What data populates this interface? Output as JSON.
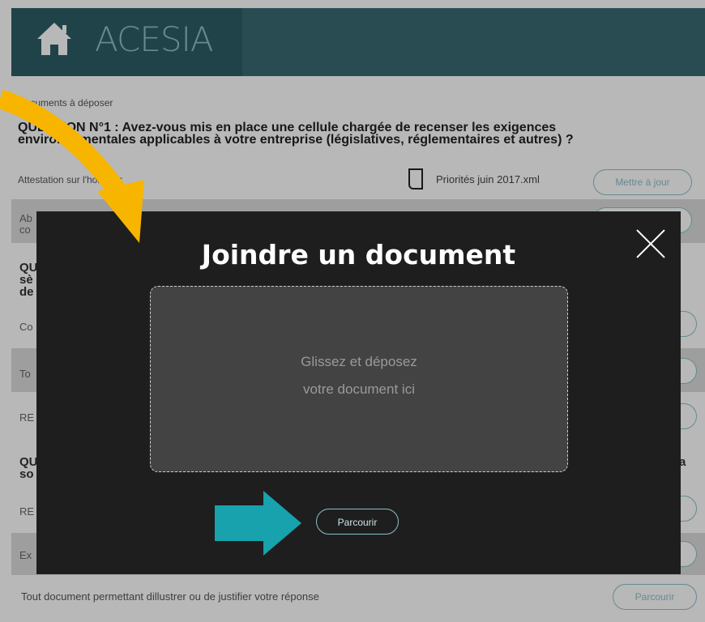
{
  "header": {
    "brand": "ACESIA",
    "home_icon": "home-icon"
  },
  "page": {
    "section_label": "Documents à déposer",
    "question1": "QUESTION N°1 : Avez-vous mis en place une cellule chargée de recenser les exigences environnementales applicables à votre entreprise (législatives, réglementaires et autres) ?",
    "row1_label": "Attestation sur l'honneur",
    "row1_file": "Priorités juin 2017.xml",
    "update_button": "Mettre à jour",
    "row2_trunc_1": "Ab",
    "row2_trunc_2": "co",
    "q2_trunc_1": "QU",
    "q2_trunc_2": "sè",
    "q2_trunc_3": "de",
    "row3_trunc": "Co",
    "row4_trunc": "To",
    "row5_trunc": "RE",
    "q3_trunc_1": "QU",
    "q3_trunc_2": "so",
    "q3_right_trunc": "a",
    "row6_trunc": "RE",
    "row7_trunc": "Ex",
    "last_row_label": "Tout document permettant dillustrer ou de justifier votre réponse",
    "last_row_button": "Parcourir"
  },
  "modal": {
    "title": "Joindre un document",
    "drop_text": "Glissez et déposez\nvotre document ici",
    "browse_button": "Parcourir",
    "close_icon": "close-icon"
  },
  "colors": {
    "header": "#3a6a73",
    "accent": "#8cc0c8",
    "modal_bg": "#1e1e1e",
    "arrow_yellow": "#f7b500",
    "arrow_teal": "#17a2ad"
  }
}
